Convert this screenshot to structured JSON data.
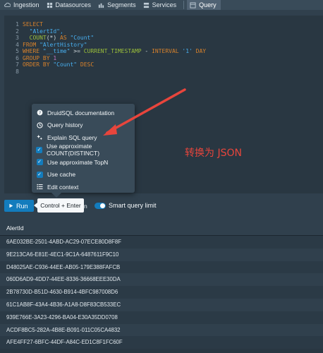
{
  "nav": {
    "items": [
      {
        "label": "Ingestion",
        "icon": "cloud-upload-icon"
      },
      {
        "label": "Datasources",
        "icon": "database-icon"
      },
      {
        "label": "Segments",
        "icon": "stacked-chart-icon"
      },
      {
        "label": "Services",
        "icon": "server-icon"
      },
      {
        "label": "Query",
        "icon": "application-icon",
        "active": true
      }
    ]
  },
  "editor": {
    "line_numbers": [
      "1",
      "2",
      "3",
      "4",
      "5",
      "6",
      "7",
      "8"
    ],
    "lines": [
      [
        {
          "t": "SELECT",
          "c": "kw"
        }
      ],
      [
        {
          "t": "  \"AlertId\",",
          "c": "str"
        }
      ],
      [
        {
          "t": "  ",
          "c": "op"
        },
        {
          "t": "COUNT",
          "c": "fn"
        },
        {
          "t": "(*) ",
          "c": "op"
        },
        {
          "t": "AS ",
          "c": "kw"
        },
        {
          "t": "\"Count\"",
          "c": "str"
        }
      ],
      [
        {
          "t": "FROM ",
          "c": "kw"
        },
        {
          "t": "\"AlertHistory\"",
          "c": "str"
        }
      ],
      [
        {
          "t": "WHERE ",
          "c": "kw"
        },
        {
          "t": "\"__time\"",
          "c": "str"
        },
        {
          "t": " >= ",
          "c": "op"
        },
        {
          "t": "CURRENT_TIMESTAMP",
          "c": "fn"
        },
        {
          "t": " - ",
          "c": "op"
        },
        {
          "t": "INTERVAL ",
          "c": "kw"
        },
        {
          "t": "'1' ",
          "c": "str"
        },
        {
          "t": "DAY",
          "c": "kw"
        }
      ],
      [
        {
          "t": "GROUP BY ",
          "c": "kw"
        },
        {
          "t": "1",
          "c": "num"
        }
      ],
      [
        {
          "t": "ORDER BY ",
          "c": "kw"
        },
        {
          "t": "\"Count\" ",
          "c": "str"
        },
        {
          "t": "DESC",
          "c": "kw"
        }
      ],
      []
    ]
  },
  "menu": {
    "items": [
      {
        "label": "DruidSQL documentation",
        "icon": "help-icon",
        "checkbox": false
      },
      {
        "label": "Query history",
        "icon": "history-icon",
        "checkbox": false
      },
      {
        "label": "Explain SQL query",
        "icon": "clean-icon",
        "checkbox": false
      },
      {
        "label": "Use approximate COUNT(DISTINCT)",
        "checkbox": true
      },
      {
        "label": "Use approximate TopN",
        "checkbox": true
      },
      {
        "label": "Use cache",
        "checkbox": true
      },
      {
        "label": "Edit context",
        "icon": "properties-icon",
        "checkbox": false
      }
    ]
  },
  "annotation": "转换为 JSON",
  "runbar": {
    "run_label": "Run",
    "tooltip": "Control + Enter",
    "tooltip_tail": "n",
    "toggle_label": "Smart query limit"
  },
  "results": {
    "header": "AlertId",
    "rows": [
      "6AE032BE-2501-4ABD-AC29-07ECE80D8F8F",
      "9E213CA6-E81E-4EC1-9C1A-6487611F9C10",
      "D48025AE-C936-44EE-AB05-179E388FAFCB",
      "060D6AD9-4DD7-44EE-8336-36668EEE30DA",
      "2B78730D-B51D-4630-B914-4BFC987008D6",
      "61C1AB8F-43A4-4B36-A1A8-D8F83CB533EC",
      "939E766E-3A23-4296-BA04-E30A35DD0708",
      "ACDF8BC5-282A-4B8E-B091-011C05CA4832",
      "AFE4FF27-6BFC-44DF-A84C-ED1C8F1FC60F"
    ]
  },
  "colors": {
    "accent": "#137cbd",
    "annotation": "#e8453c",
    "background": "#30404d"
  }
}
